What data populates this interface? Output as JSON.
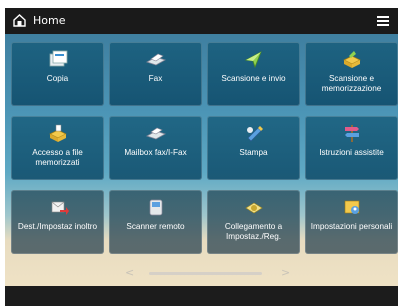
{
  "header": {
    "title": "Home",
    "home_icon": "home-icon",
    "menu_icon": "menu-icon"
  },
  "colors": {
    "topbar": "#1a1a1a",
    "tile": "#145a78",
    "text": "#ffffff"
  },
  "tiles": [
    {
      "label": "Copia",
      "icon": "copy-icon"
    },
    {
      "label": "Fax",
      "icon": "fax-icon"
    },
    {
      "label": "Scansione e invio",
      "icon": "scan-send-icon"
    },
    {
      "label": "Scansione e memorizzazione",
      "icon": "scan-store-icon"
    },
    {
      "label": "Accesso a file memorizzati",
      "icon": "stored-files-icon"
    },
    {
      "label": "Mailbox fax/I-Fax",
      "icon": "mailbox-icon"
    },
    {
      "label": "Stampa",
      "icon": "print-icon"
    },
    {
      "label": "Istruzioni assistite",
      "icon": "signpost-icon"
    },
    {
      "label": "Dest./Impostaz inoltro",
      "icon": "forward-icon"
    },
    {
      "label": "Scanner remoto",
      "icon": "remote-scanner-icon"
    },
    {
      "label": "Collegamento a Impostaz./Reg.",
      "icon": "settings-link-icon"
    },
    {
      "label": "Impostazioni personali",
      "icon": "personal-settings-icon"
    }
  ],
  "pager": {
    "prev_icon": "chevron-left-icon",
    "next_icon": "chevron-right-icon",
    "prev": "<",
    "next": ">"
  }
}
